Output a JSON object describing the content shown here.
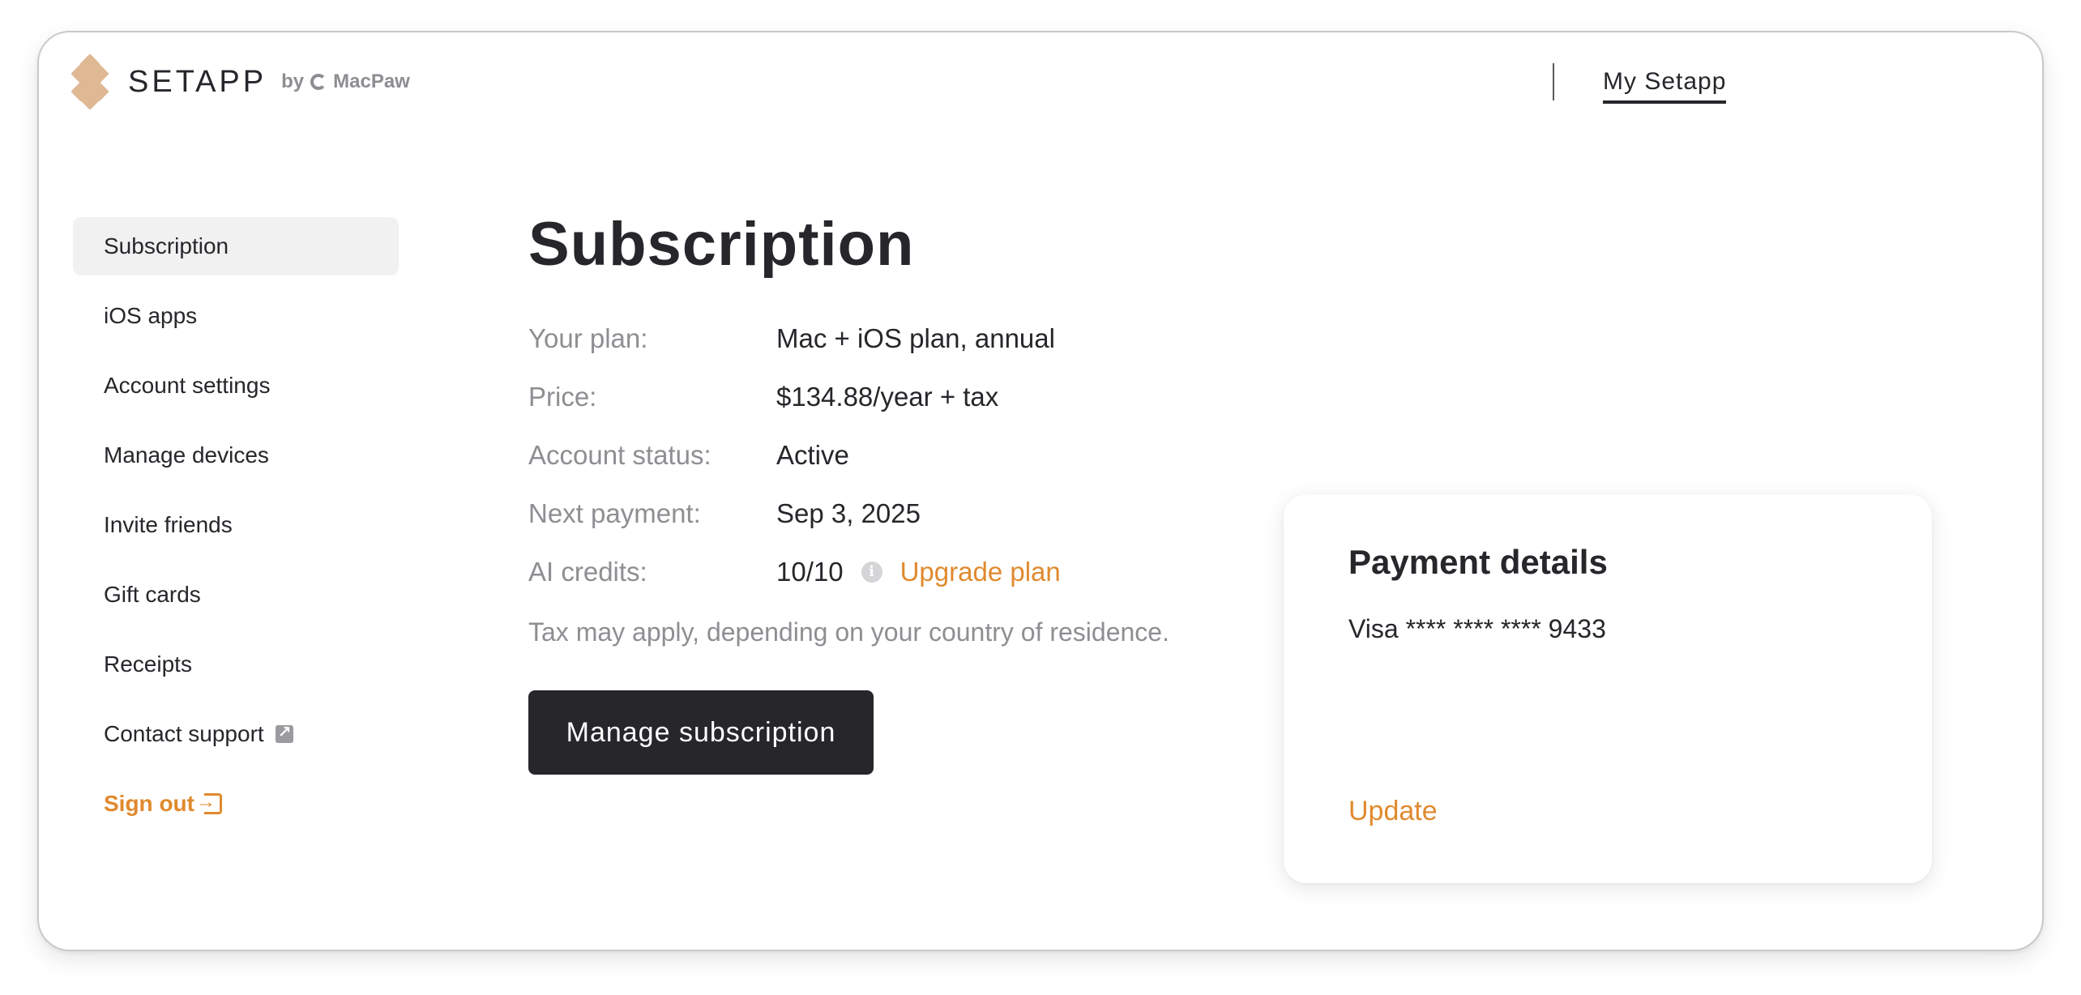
{
  "header": {
    "logo_text": "SETAPP",
    "by_text": "by",
    "company_text": "MacPaw",
    "nav_label": "My Setapp"
  },
  "sidebar": {
    "items": [
      {
        "label": "Subscription",
        "active": true
      },
      {
        "label": "iOS apps"
      },
      {
        "label": "Account settings"
      },
      {
        "label": "Manage devices"
      },
      {
        "label": "Invite friends"
      },
      {
        "label": "Gift cards"
      },
      {
        "label": "Receipts"
      },
      {
        "label": "Contact support",
        "icon": "external-link-icon"
      },
      {
        "label": "Sign out",
        "icon": "sign-out-icon"
      }
    ]
  },
  "main": {
    "title": "Subscription",
    "details": [
      {
        "label": "Your plan:",
        "value": "Mac + iOS plan, annual"
      },
      {
        "label": "Price:",
        "value": "$134.88/year + tax"
      },
      {
        "label": "Account status:",
        "value": "Active"
      },
      {
        "label": "Next payment:",
        "value": "Sep 3, 2025"
      },
      {
        "label": "AI credits:",
        "value": "10/10",
        "info_icon": "info-icon",
        "link": "Upgrade plan"
      }
    ],
    "tax_note": "Tax may apply, depending on your country of residence.",
    "manage_button": "Manage subscription"
  },
  "payment": {
    "title": "Payment details",
    "card": "Visa **** **** **** 9433",
    "update_link": "Update"
  },
  "colors": {
    "accent": "#e08a2e",
    "dark": "#26262b",
    "muted": "#8e8e93",
    "logo": "#dfb894"
  }
}
